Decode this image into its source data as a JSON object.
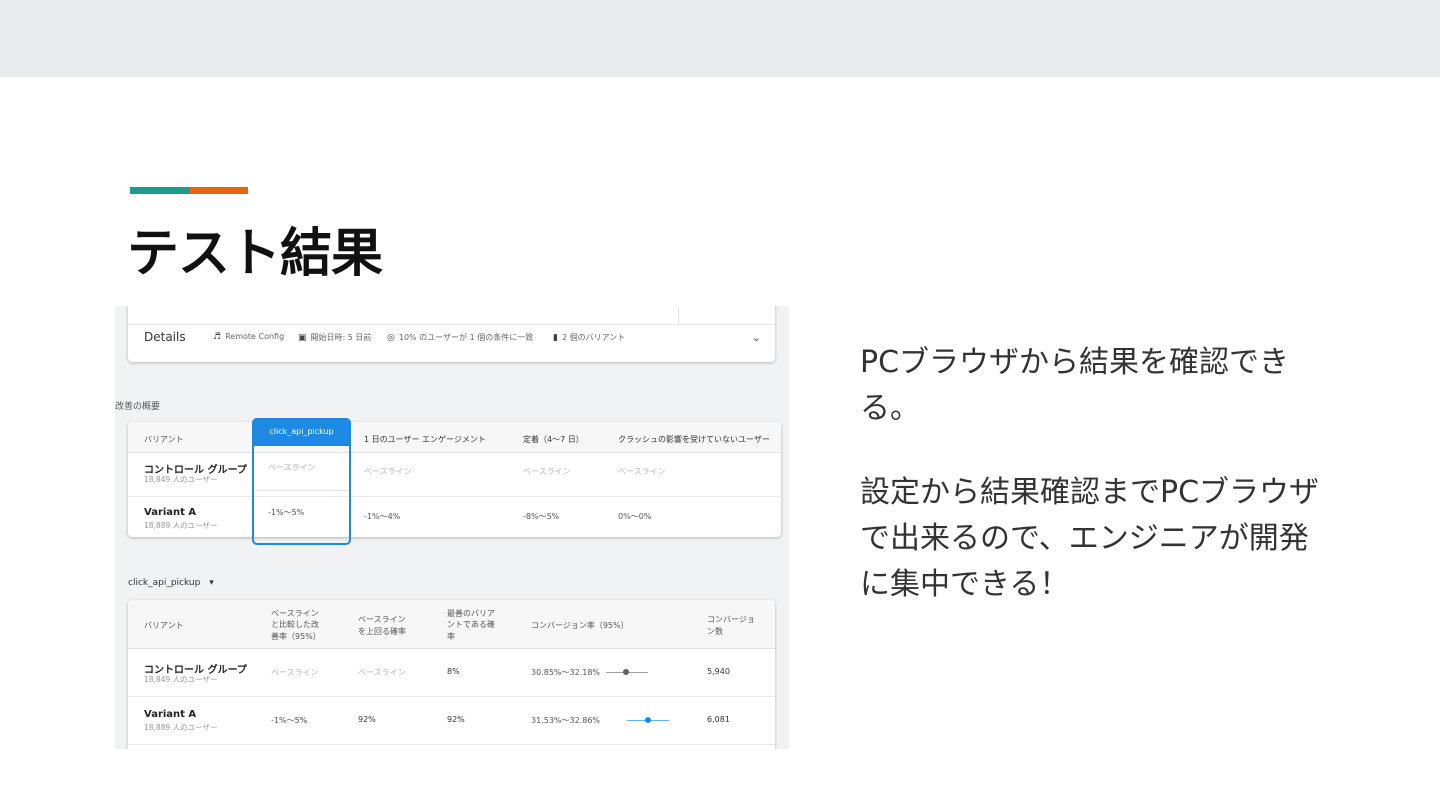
{
  "slide": {
    "title": "テスト結果",
    "colors": {
      "accent_teal": "#1f9a8e",
      "accent_orange": "#e8640e",
      "highlight_blue": "#1e88e5"
    },
    "paragraphs": [
      "PCブラウザから結果を確認できる。",
      "設定から結果確認までPCブラウザで出来るので、エンジニアが開発に集中できる！"
    ]
  },
  "screenshot": {
    "details": {
      "title": "Details",
      "meta": [
        {
          "icon": "remote-config-icon",
          "glyph": "♬",
          "text": "Remote Config"
        },
        {
          "icon": "calendar-icon",
          "glyph": "▣",
          "text": "開始日時: 5 日前"
        },
        {
          "icon": "target-icon",
          "glyph": "◎",
          "text": "10% のユーザーが 1 個の条件に一致"
        },
        {
          "icon": "variants-icon",
          "glyph": "▮",
          "text": "2 個のバリアント"
        }
      ],
      "expand_icon": "⌄"
    },
    "summary": {
      "label": "改善の概要",
      "headers": [
        "バリアント",
        "click_api_pickup",
        "1 日のユーザー エンゲージメント",
        "定着（4〜7 日）",
        "クラッシュの影響を受けていないユーザー"
      ],
      "rows": [
        {
          "name": "コントロール グループ",
          "users": "18,849 人のユーザー",
          "values": [
            "ベースライン",
            "ベースライン",
            "ベースライン",
            "ベースライン"
          ]
        },
        {
          "name": "Variant A",
          "users": "18,889 人のユーザー",
          "values": [
            "-1%〜5%",
            "-1%〜4%",
            "-8%〜5%",
            "0%〜0%"
          ]
        }
      ]
    },
    "metric": {
      "selector_label": "click_api_pickup",
      "selector_icon": "▾",
      "headers": {
        "variant": "バリアント",
        "improvement": [
          "ベースライン",
          "と比較した改",
          "善率（95%）"
        ],
        "prob_beat": [
          "ベースライン",
          "を上回る確率"
        ],
        "prob_best": [
          "最善のバリア",
          "ントである確",
          "率"
        ],
        "conv_rate": "コンバージョン率（95%）",
        "conversions": [
          "コンバージョ",
          "ン数"
        ]
      },
      "rows": [
        {
          "name": "コントロール グループ",
          "users": "18,849 人のユーザー",
          "improvement": "ベースライン",
          "prob_beat": "ベースライン",
          "prob_best": "8%",
          "conv_rate": "30.85%〜32.18%",
          "conversions": "5,940",
          "ci_color": "#9e9e9e",
          "dot_color": "#616161"
        },
        {
          "name": "Variant A",
          "users": "18,889 人のユーザー",
          "improvement": "-1%〜5%",
          "prob_beat": "92%",
          "prob_best": "92%",
          "conv_rate": "31.53%〜32.86%",
          "conversions": "6,081",
          "ci_color": "#64b5f6",
          "dot_color": "#1e88e5"
        }
      ]
    }
  }
}
